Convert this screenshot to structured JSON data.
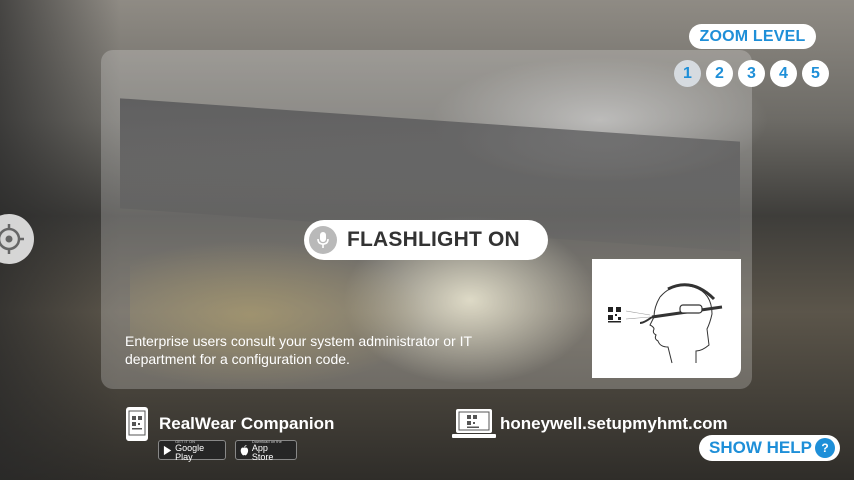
{
  "zoom": {
    "label": "ZOOM LEVEL",
    "levels": [
      "1",
      "2",
      "3",
      "4",
      "5"
    ],
    "selected": "1"
  },
  "voice_command": {
    "icon": "microphone-icon",
    "text": "FLASHLIGHT ON"
  },
  "info": {
    "text": "Enterprise users consult your system administrator or IT department for a configuration code."
  },
  "companion": {
    "title": "RealWear Companion",
    "google_small": "GET IT ON",
    "google_big": "Google Play",
    "apple_small": "Download on the",
    "apple_big": "App Store"
  },
  "website": {
    "url": "honeywell.setupmyhmt.com"
  },
  "help": {
    "label": "SHOW HELP",
    "icon_text": "?"
  },
  "colors": {
    "accent": "#1e8fd8",
    "pill_bg": "#ffffff"
  }
}
